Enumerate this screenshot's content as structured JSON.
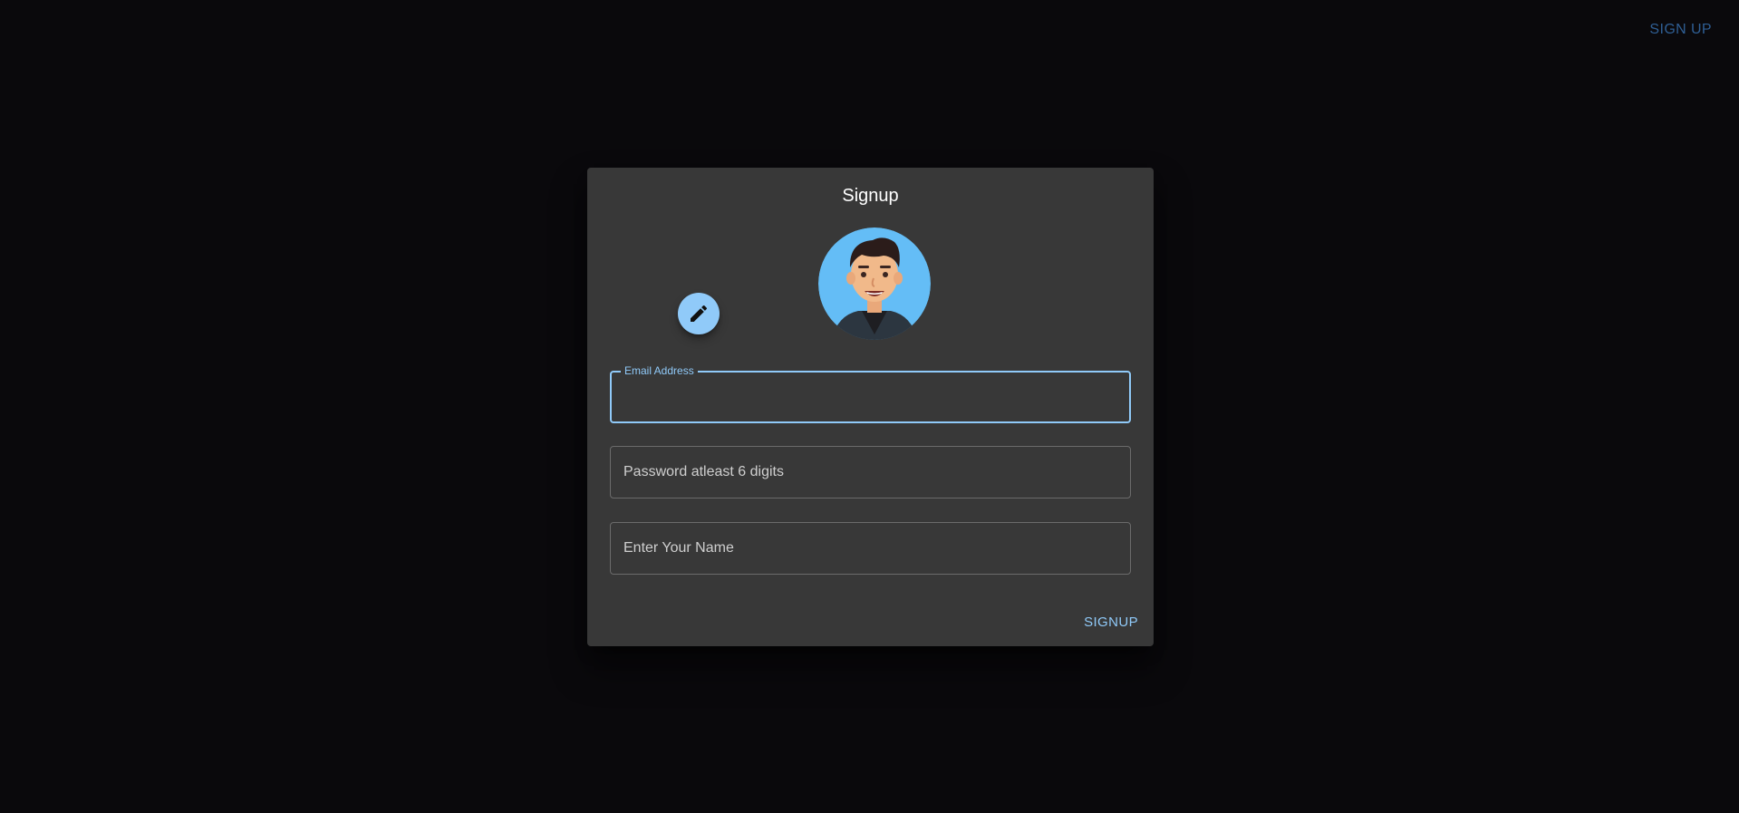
{
  "header": {
    "signup_link": "SIGN UP"
  },
  "dialog": {
    "title": "Signup",
    "avatar_edit_icon": "pencil-icon",
    "email": {
      "label": "Email Address",
      "value": "",
      "placeholder": ""
    },
    "password": {
      "placeholder": "Password atleast 6 digits",
      "value": ""
    },
    "name": {
      "placeholder": "Enter Your Name",
      "value": ""
    },
    "submit_label": "SIGNUP"
  },
  "colors": {
    "background": "#0a090c",
    "dialog": "#383838",
    "accent": "#90caf9",
    "header_link": "#2f5f95"
  }
}
